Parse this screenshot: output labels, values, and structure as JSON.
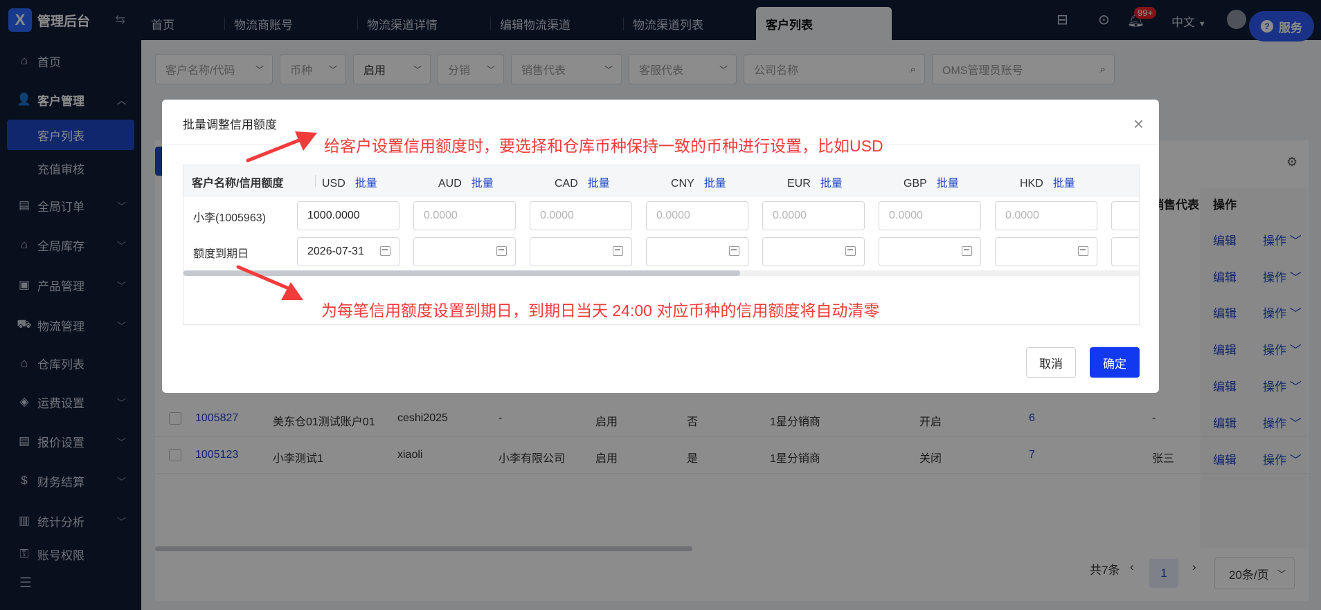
{
  "app": {
    "logo_letter": "X",
    "title": "管理后台"
  },
  "sidebar": {
    "items": [
      {
        "label": "首页",
        "icon": "home-icon"
      },
      {
        "label": "客户管理",
        "icon": "user-icon"
      },
      {
        "label": "全局订单",
        "icon": "order-icon"
      },
      {
        "label": "全局库存",
        "icon": "warehouse-icon"
      },
      {
        "label": "产品管理",
        "icon": "box-icon"
      },
      {
        "label": "物流管理",
        "icon": "truck-icon"
      },
      {
        "label": "仓库列表",
        "icon": "building-icon"
      },
      {
        "label": "运费设置",
        "icon": "freight-icon"
      },
      {
        "label": "报价设置",
        "icon": "quote-icon"
      },
      {
        "label": "财务结算",
        "icon": "finance-icon"
      },
      {
        "label": "统计分析",
        "icon": "chart-icon"
      },
      {
        "label": "账号权限",
        "icon": "key-icon"
      }
    ],
    "sub_items": [
      {
        "label": "客户列表"
      },
      {
        "label": "充值审核"
      }
    ]
  },
  "tabs": [
    {
      "label": "首页"
    },
    {
      "label": "物流商账号"
    },
    {
      "label": "物流渠道详情"
    },
    {
      "label": "编辑物流渠道"
    },
    {
      "label": "物流渠道列表"
    },
    {
      "label": "客户列表"
    }
  ],
  "topbar": {
    "badge": "99+",
    "language": "中文",
    "service_label": "服务"
  },
  "filters": {
    "customer": "客户名称/代码",
    "currency": "币种",
    "status": "启用",
    "distribution": "分销",
    "sales_rep": "销售代表",
    "service_rep": "客服代表",
    "company": "公司名称",
    "oms_admin": "OMS管理员账号"
  },
  "table": {
    "headers": {
      "sales": "销售代表",
      "ops": "操作"
    },
    "edit_label": "编辑",
    "op_label": "操作",
    "rows": [
      {
        "id": "1005827",
        "name": "美东仓01测试账户01",
        "code": "ceshi2025",
        "company": "-",
        "status": "启用",
        "flag": "否",
        "tier": "1星分销商",
        "switch": "开启",
        "count": "6",
        "sales": "-"
      },
      {
        "id": "1005123",
        "name": "小李测试1",
        "code": "xiaoli",
        "company": "小李有限公司",
        "status": "启用",
        "flag": "是",
        "tier": "1星分销商",
        "switch": "关闭",
        "count": "7",
        "sales": "张三"
      }
    ]
  },
  "pagination": {
    "total": "共7条",
    "page": "1",
    "page_size": "20条/页"
  },
  "modal": {
    "title": "批量调整信用额度",
    "close": "×",
    "first_col_header": "客户名称/信用额度",
    "batch_label": "批量",
    "currencies": [
      "USD",
      "AUD",
      "CAD",
      "CNY",
      "EUR",
      "GBP",
      "HKD"
    ],
    "rows": {
      "customer": "小李(1005963)",
      "expiry_label": "额度到期日"
    },
    "amounts": [
      "1000.0000",
      "0.0000",
      "0.0000",
      "0.0000",
      "0.0000",
      "0.0000",
      "0.0000"
    ],
    "dates": [
      "2026-07-31",
      "",
      "",
      "",
      "",
      "",
      ""
    ],
    "annotation_top": "给客户设置信用额度时，要选择和仓库币种保持一致的币种进行设置，比如USD",
    "annotation_bottom": "为每笔信用额度设置到期日，到期日当天 24:00 对应币种的信用额度将自动清零",
    "cancel": "取消",
    "confirm": "确定",
    "annotation_color": "#f23b3b"
  }
}
